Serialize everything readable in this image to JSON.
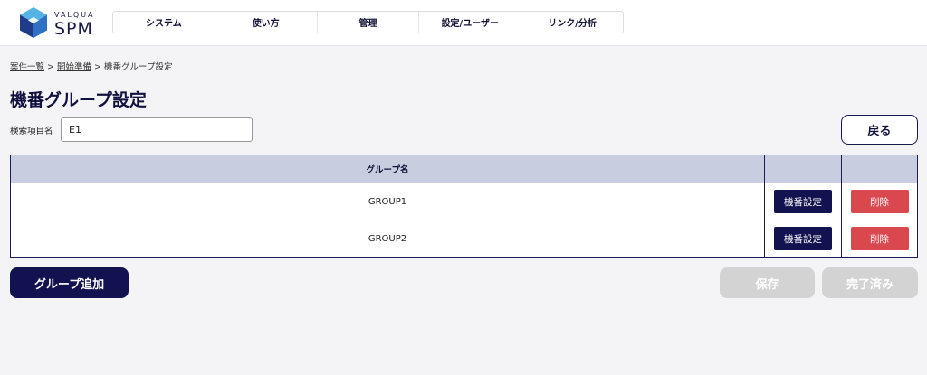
{
  "brand": {
    "small": "VALQUA",
    "big": "SPM"
  },
  "nav": [
    "システム",
    "使い方",
    "管理",
    "設定/ユーザー",
    "リンク/分析"
  ],
  "breadcrumb": {
    "item1": "案件一覧",
    "sep": " > ",
    "item2": "開始準備",
    "current": "機番グループ設定"
  },
  "page": {
    "title": "機番グループ設定"
  },
  "search": {
    "label": "検索項目名",
    "value": "E1"
  },
  "buttons": {
    "back": "戻る",
    "add_group": "グループ追加",
    "save": "保存",
    "done": "完了済み"
  },
  "table": {
    "header": {
      "group_name": "グループ名"
    },
    "rows": [
      {
        "name": "GROUP1",
        "setting": "機番設定",
        "delete": "削除"
      },
      {
        "name": "GROUP2",
        "setting": "機番設定",
        "delete": "削除"
      }
    ]
  },
  "colors": {
    "navy": "#121250",
    "delete_red": "#d9474f",
    "table_header": "#c8cee0",
    "disabled_gray": "#d3d3d3"
  }
}
